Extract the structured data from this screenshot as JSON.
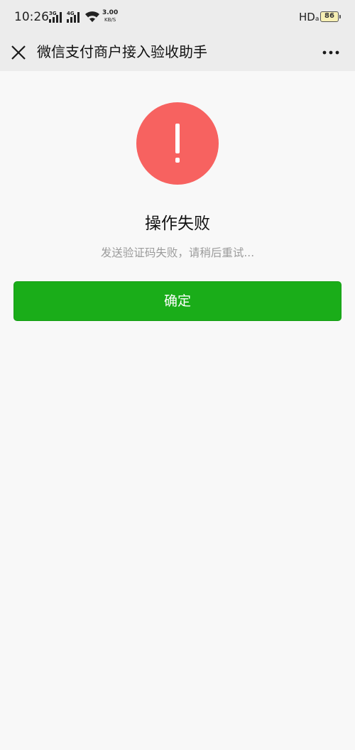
{
  "status_bar": {
    "time": "10:26",
    "network_1": "3G",
    "network_2": "4G",
    "speed_value": "3.00",
    "speed_unit": "KB/S",
    "hd_label": "HD",
    "hd_sub": "a",
    "battery_level": "86",
    "icons": [
      "signal-icon",
      "signal-icon",
      "wifi-icon",
      "battery-icon"
    ]
  },
  "title_bar": {
    "title": "微信支付商户接入验收助手",
    "close_icon": "close-icon",
    "more_icon": "more-icon"
  },
  "result": {
    "icon": "warning-icon",
    "icon_color": "#f76260",
    "title": "操作失败",
    "description": "发送验证码失败，请稍后重试..."
  },
  "actions": {
    "confirm_label": "确定",
    "confirm_color": "#1aad19"
  }
}
